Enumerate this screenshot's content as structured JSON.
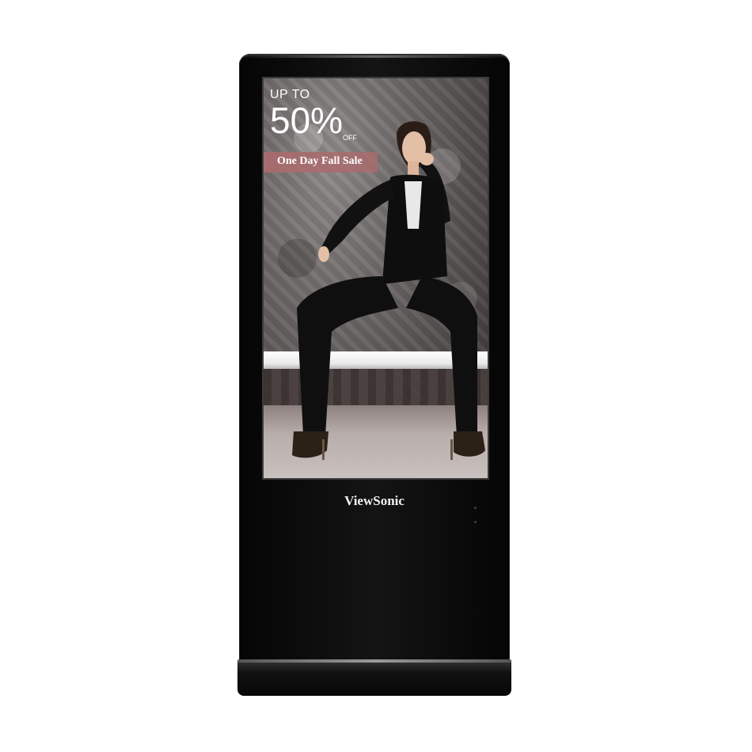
{
  "promo": {
    "up_to": "UP TO",
    "percent": "50%",
    "off": "OFF",
    "banner": "One Day Fall Sale"
  },
  "device": {
    "brand": "ViewSonic",
    "colors": {
      "body": "#0b0b0b",
      "banner": "#a86c6e",
      "background": "#ffffff"
    }
  }
}
